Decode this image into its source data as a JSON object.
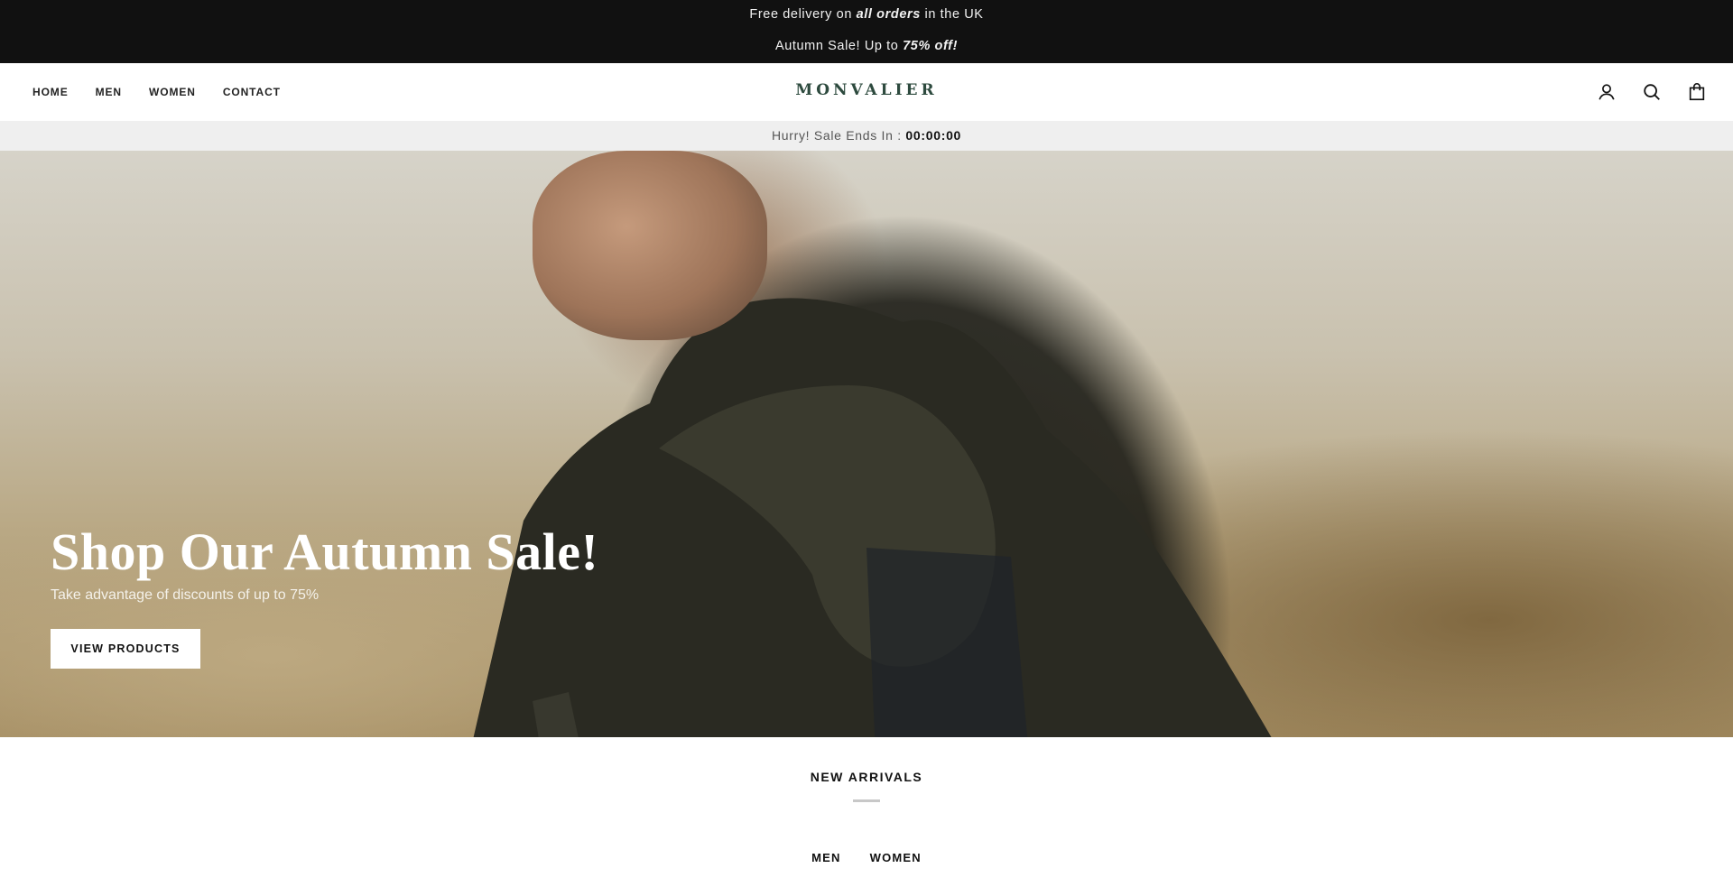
{
  "announcement": {
    "line1": {
      "before": "Free delivery on ",
      "emphasis": "all orders",
      "after": " in the UK"
    },
    "line2": {
      "before": "Autumn Sale! Up to ",
      "emphasis": "75% off!"
    },
    "background": "#111111"
  },
  "header": {
    "nav": [
      "HOME",
      "MEN",
      "WOMEN",
      "CONTACT"
    ],
    "logo": "MONVALIER",
    "logo_color": "#2d4a3e",
    "icons": [
      "account-icon",
      "search-icon",
      "cart-icon"
    ]
  },
  "countdown": {
    "label": "Hurry! Sale Ends In : ",
    "time": "00:00:00"
  },
  "hero": {
    "title": "Shop Our Autumn Sale!",
    "subtitle": "Take advantage of discounts of up to 75%",
    "button": "VIEW PRODUCTS"
  },
  "new_arrivals": {
    "title": "NEW ARRIVALS",
    "tabs": [
      "MEN",
      "WOMEN"
    ]
  }
}
